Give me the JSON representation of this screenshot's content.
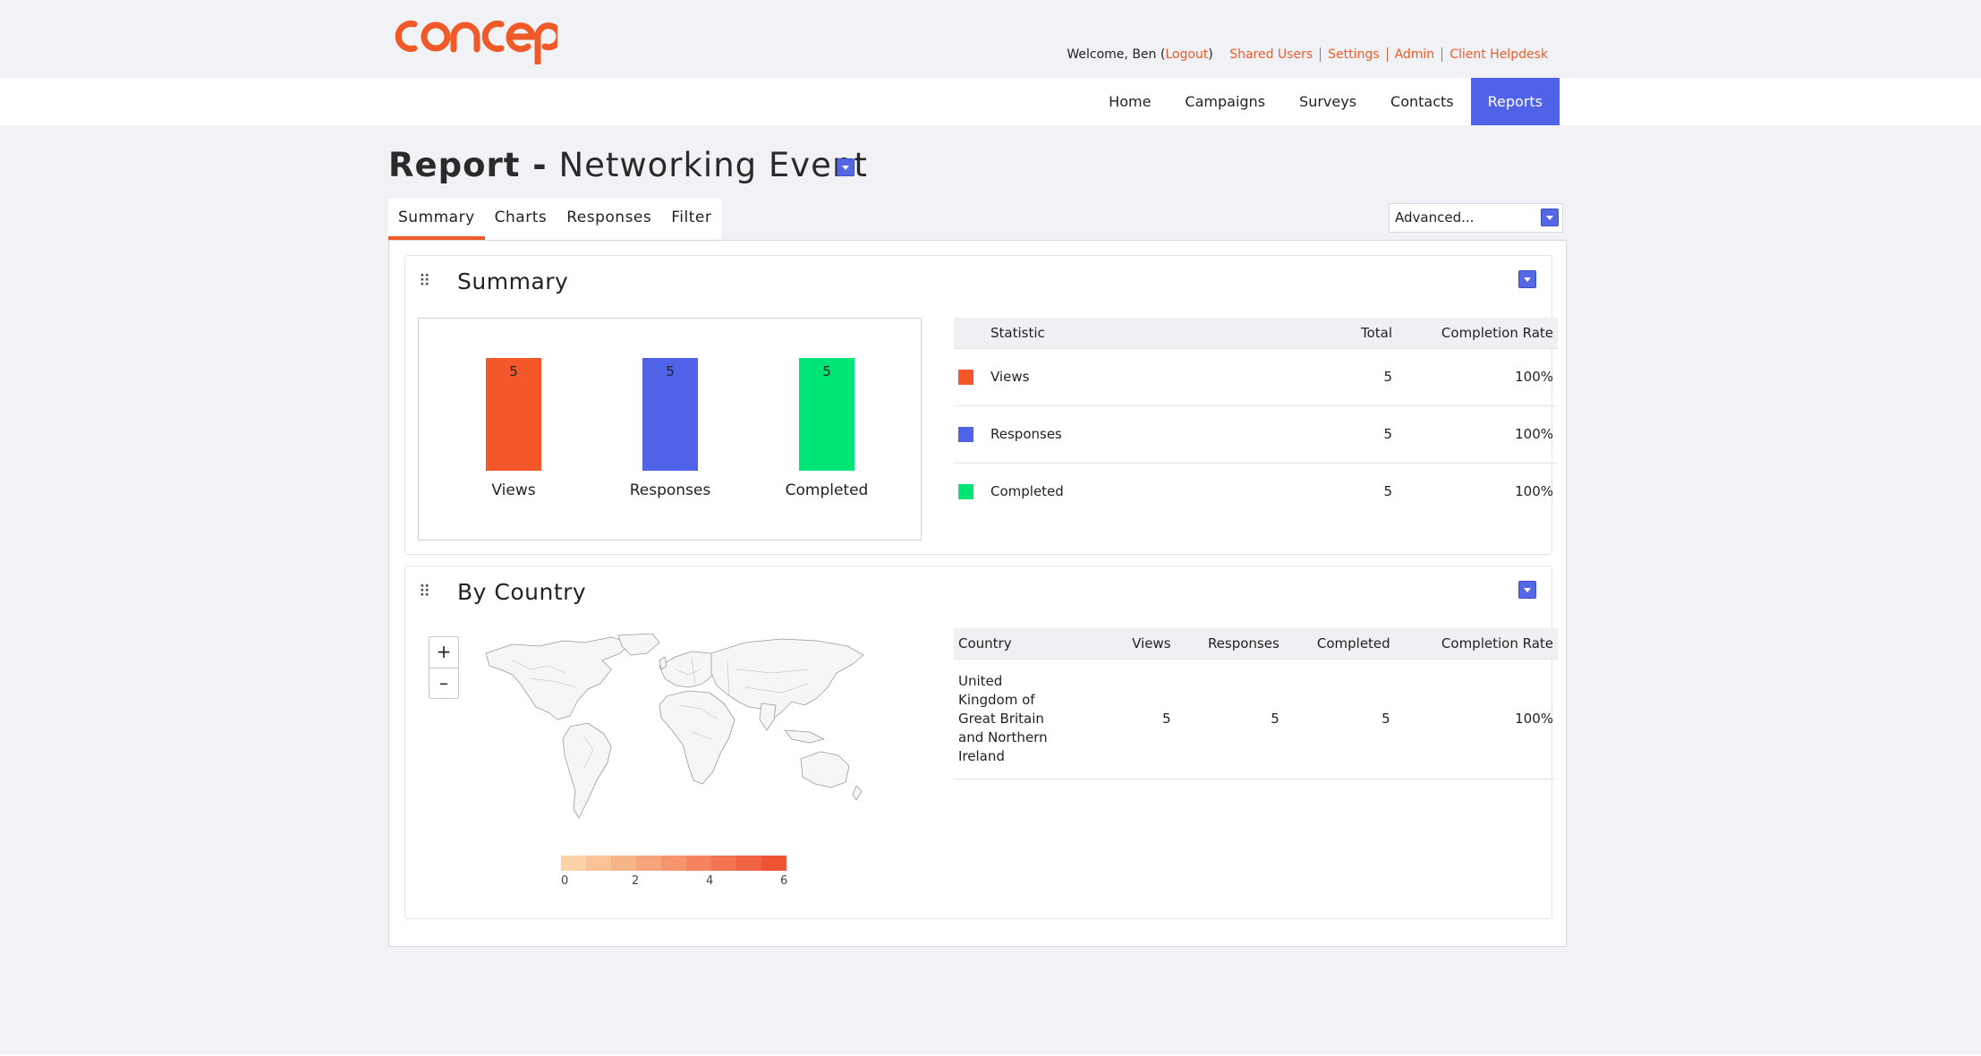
{
  "header": {
    "welcome_prefix": "Welcome, Ben (",
    "logout": "Logout",
    "welcome_suffix": ")",
    "links": [
      "Shared Users",
      "Settings",
      "Admin",
      "Client Helpdesk"
    ]
  },
  "nav": {
    "items": [
      "Home",
      "Campaigns",
      "Surveys",
      "Contacts",
      "Reports"
    ],
    "active": "Reports"
  },
  "page": {
    "title_prefix": "Report -",
    "title_name": "Networking Event"
  },
  "tabs": [
    "Summary",
    "Charts",
    "Responses",
    "Filter"
  ],
  "advanced": {
    "value": "Advanced..."
  },
  "summary": {
    "title": "Summary",
    "headers": [
      "Statistic",
      "Total",
      "Completion Rate"
    ],
    "rows": [
      {
        "label": "Views",
        "total": "5",
        "rate": "100%",
        "color": "#f4572a"
      },
      {
        "label": "Responses",
        "total": "5",
        "rate": "100%",
        "color": "#4f62e8"
      },
      {
        "label": "Completed",
        "total": "5",
        "rate": "100%",
        "color": "#00e676"
      }
    ]
  },
  "chart_data": {
    "type": "bar",
    "categories": [
      "Views",
      "Responses",
      "Completed"
    ],
    "values": [
      5,
      5,
      5
    ],
    "colors": [
      "#f4572a",
      "#4f62e8",
      "#00e676"
    ],
    "data_labels": true,
    "grid": false,
    "ylim": [
      0,
      5
    ]
  },
  "country": {
    "title": "By Country",
    "zoom_in": "+",
    "zoom_out": "–",
    "headers": [
      "Country",
      "Views",
      "Responses",
      "Completed",
      "Completion Rate"
    ],
    "rows": [
      {
        "country": "United Kingdom of Great Britain and Northern Ireland",
        "views": "5",
        "responses": "5",
        "completed": "5",
        "rate": "100%"
      }
    ],
    "legend_ticks": [
      "0",
      "2",
      "4",
      "6"
    ],
    "legend_colors": [
      "#fbd3a6",
      "#f9c397",
      "#f8b489",
      "#f6a47b",
      "#f5946d",
      "#f3845f",
      "#f27451",
      "#f06443",
      "#ef5535"
    ]
  }
}
